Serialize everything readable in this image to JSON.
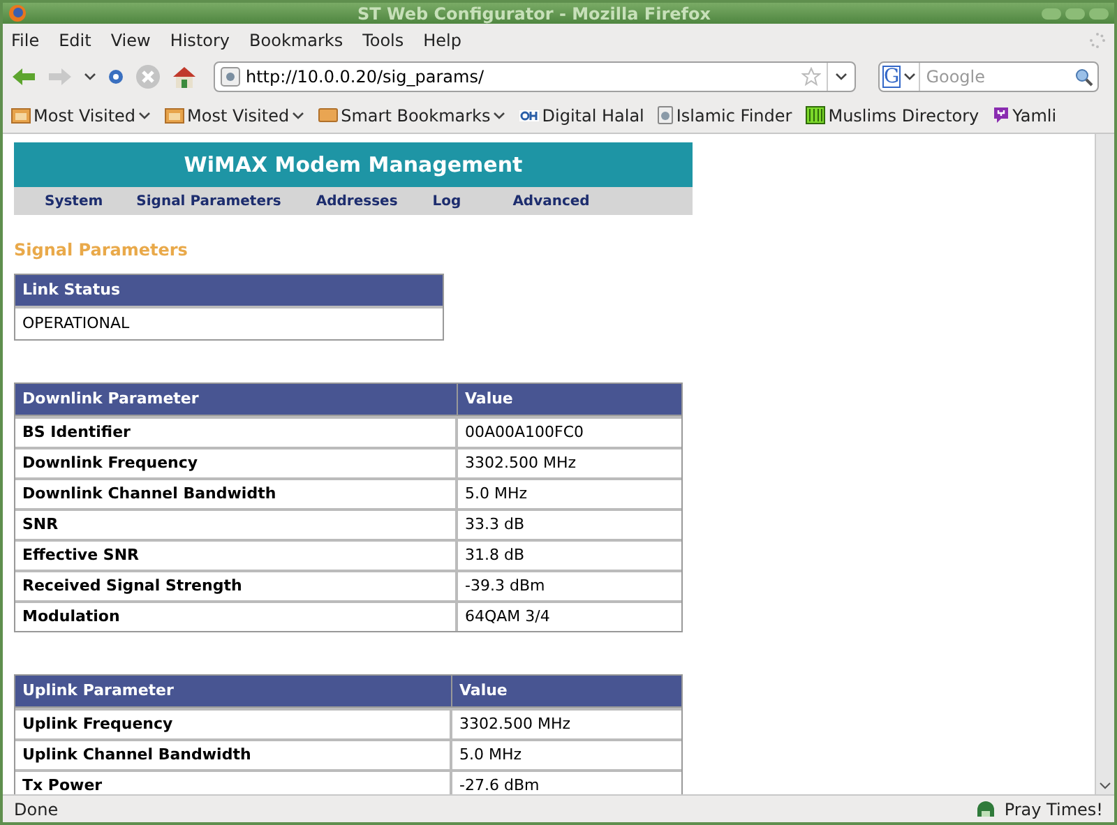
{
  "window": {
    "title": "ST Web Configurator - Mozilla Firefox"
  },
  "menu": [
    "File",
    "Edit",
    "View",
    "History",
    "Bookmarks",
    "Tools",
    "Help"
  ],
  "address_bar": {
    "value": "http://10.0.0.20/sig_params/"
  },
  "search": {
    "engine_letter": "G",
    "placeholder": "Google"
  },
  "bookmarks": [
    {
      "label": "Most Visited",
      "kind": "folder",
      "dropdown": true
    },
    {
      "label": "Most Visited",
      "kind": "folder",
      "dropdown": true
    },
    {
      "label": "Smart Bookmarks",
      "kind": "smart",
      "dropdown": true
    },
    {
      "label": "Digital Halal",
      "kind": "oh",
      "dropdown": false
    },
    {
      "label": "Islamic Finder",
      "kind": "page",
      "dropdown": false
    },
    {
      "label": "Muslims Directory",
      "kind": "grid",
      "dropdown": false
    },
    {
      "label": "Yamli",
      "kind": "yamli",
      "dropdown": false
    }
  ],
  "page": {
    "banner": "WiMAX Modem Management",
    "nav": [
      "System",
      "Signal Parameters",
      "Addresses",
      "Log",
      "Advanced"
    ],
    "heading": "Signal Parameters",
    "link_status": {
      "header": "Link Status",
      "value": "OPERATIONAL"
    },
    "tables": [
      {
        "columns": [
          "Downlink Parameter",
          "Value"
        ],
        "rows": [
          [
            "BS Identifier",
            "00A00A100FC0"
          ],
          [
            "Downlink Frequency",
            "3302.500 MHz"
          ],
          [
            "Downlink Channel Bandwidth",
            "5.0 MHz"
          ],
          [
            "SNR",
            "33.3 dB"
          ],
          [
            "Effective SNR",
            "31.8 dB"
          ],
          [
            "Received Signal Strength",
            "-39.3 dBm"
          ],
          [
            "Modulation",
            "64QAM 3/4"
          ]
        ]
      },
      {
        "columns": [
          "Uplink Parameter",
          "Value"
        ],
        "rows": [
          [
            "Uplink Frequency",
            "3302.500 MHz"
          ],
          [
            "Uplink Channel Bandwidth",
            "5.0 MHz"
          ],
          [
            "Tx Power",
            "-27.6 dBm"
          ]
        ]
      }
    ]
  },
  "status_bar": {
    "text": "Done",
    "addon": "Pray Times!"
  }
}
